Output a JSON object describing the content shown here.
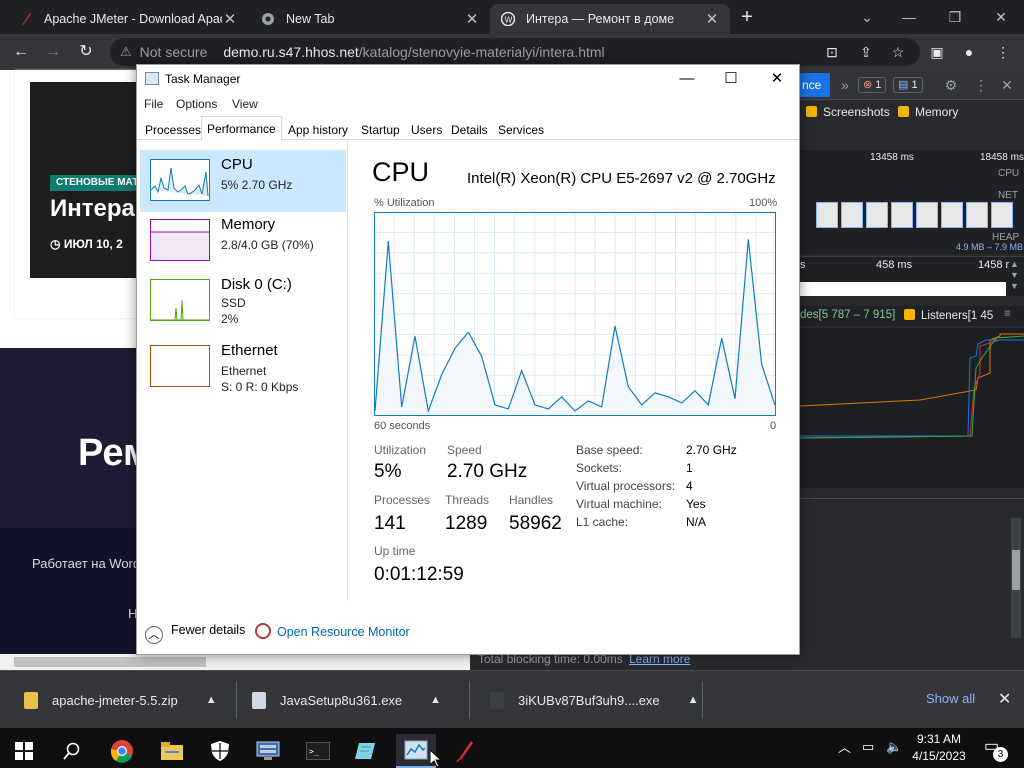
{
  "browser": {
    "tabs": [
      {
        "title": "Apache JMeter - Download Apac",
        "icon": "feather-icon"
      },
      {
        "title": "New Tab",
        "icon": "chrome-icon"
      },
      {
        "title": "Интера — Ремонт в доме",
        "icon": "wordpress-icon"
      }
    ],
    "address": {
      "security": "Not secure",
      "domain": "demo.ru.s47.hhos.net",
      "path": "/katalog/stenovyie-materialyi/intera.html"
    }
  },
  "webpage": {
    "badge": "СТЕНОВЫЕ МАТ",
    "hero_title": "Интера",
    "hero_date": "ИЮЛ 10, 2",
    "big_title": "Рем",
    "footer_text": "Работает на Word",
    "footer_text2": "Н"
  },
  "devtools": {
    "active_tab": "nce",
    "errors": "1",
    "messages": "1",
    "checkbox_screenshots": "Screenshots",
    "checkbox_memory": "Memory",
    "time1": "13458 ms",
    "time2": "18458 ms",
    "lane_cpu": "CPU",
    "lane_net": "NET",
    "lane_heap": "HEAP",
    "heap_range": "4.9 MB – 7.9 MB",
    "ruler1": "s",
    "ruler2": "458 ms",
    "ruler3": "1458 r",
    "nodes": "des[5 787 – 7 915]",
    "listeners": "Listeners[1 45",
    "blocking_time": "Total blocking time: 0.00ms",
    "learn_more": "Learn more"
  },
  "taskmanager": {
    "title": "Task Manager",
    "menu": [
      "File",
      "Options",
      "View"
    ],
    "tabs": [
      "Processes",
      "Performance",
      "App history",
      "Startup",
      "Users",
      "Details",
      "Services"
    ],
    "selected_tab": "Performance",
    "resources": [
      {
        "name": "CPU",
        "line1": "5% 2.70 GHz",
        "line2": ""
      },
      {
        "name": "Memory",
        "line1": "2.8/4.0 GB (70%)",
        "line2": ""
      },
      {
        "name": "Disk 0 (C:)",
        "line1": "SSD",
        "line2": "2%"
      },
      {
        "name": "Ethernet",
        "line1": "Ethernet",
        "line2": "S: 0 R: 0 Kbps"
      }
    ],
    "heading": "CPU",
    "model": "Intel(R) Xeon(R) CPU E5-2697 v2 @ 2.70GHz",
    "util_label": "% Utilization",
    "util_max": "100%",
    "time_span": "60 seconds",
    "time_zero": "0",
    "stats": {
      "utilization_label": "Utilization",
      "utilization": "5%",
      "speed_label": "Speed",
      "speed": "2.70 GHz",
      "processes_label": "Processes",
      "processes": "141",
      "threads_label": "Threads",
      "threads": "1289",
      "handles_label": "Handles",
      "handles": "58962",
      "uptime_label": "Up time",
      "uptime": "0:01:12:59"
    },
    "details": [
      {
        "k": "Base speed:",
        "v": "2.70 GHz"
      },
      {
        "k": "Sockets:",
        "v": "1"
      },
      {
        "k": "Virtual processors:",
        "v": "4"
      },
      {
        "k": "Virtual machine:",
        "v": "Yes"
      },
      {
        "k": "L1 cache:",
        "v": "N/A"
      }
    ],
    "fewer_details": "Fewer details",
    "resource_monitor": "Open Resource Monitor",
    "cpu_graph_values": [
      28,
      20,
      24,
      19,
      23,
      24,
      18,
      19,
      29,
      22,
      19,
      21,
      15,
      18,
      7,
      2,
      3,
      2,
      3,
      2,
      3,
      5,
      8,
      9,
      7,
      4,
      6,
      10,
      12,
      9,
      8,
      6,
      4,
      3,
      5,
      7,
      15,
      18,
      15,
      10,
      8,
      5,
      6,
      5,
      4,
      4,
      22,
      25,
      30,
      20,
      15,
      10,
      12,
      25
    ],
    "cpu_graph_peaks": [
      2,
      86,
      4,
      39,
      2,
      20,
      33,
      41,
      29,
      5,
      3,
      22,
      5,
      3,
      9,
      2,
      7,
      4,
      44,
      14,
      5,
      11,
      9,
      6,
      12,
      5,
      38,
      8,
      87,
      25,
      5
    ],
    "graph_color": "#117dbb"
  },
  "downloads": [
    {
      "name": "apache-jmeter-5.5.zip"
    },
    {
      "name": "JavaSetup8u361.exe"
    },
    {
      "name": "3iKUBv87Buf3uh9....exe"
    }
  ],
  "download_show_all": "Show all",
  "taskbar": {
    "time": "9:31 AM",
    "date": "4/15/2023",
    "notifications": "3"
  }
}
